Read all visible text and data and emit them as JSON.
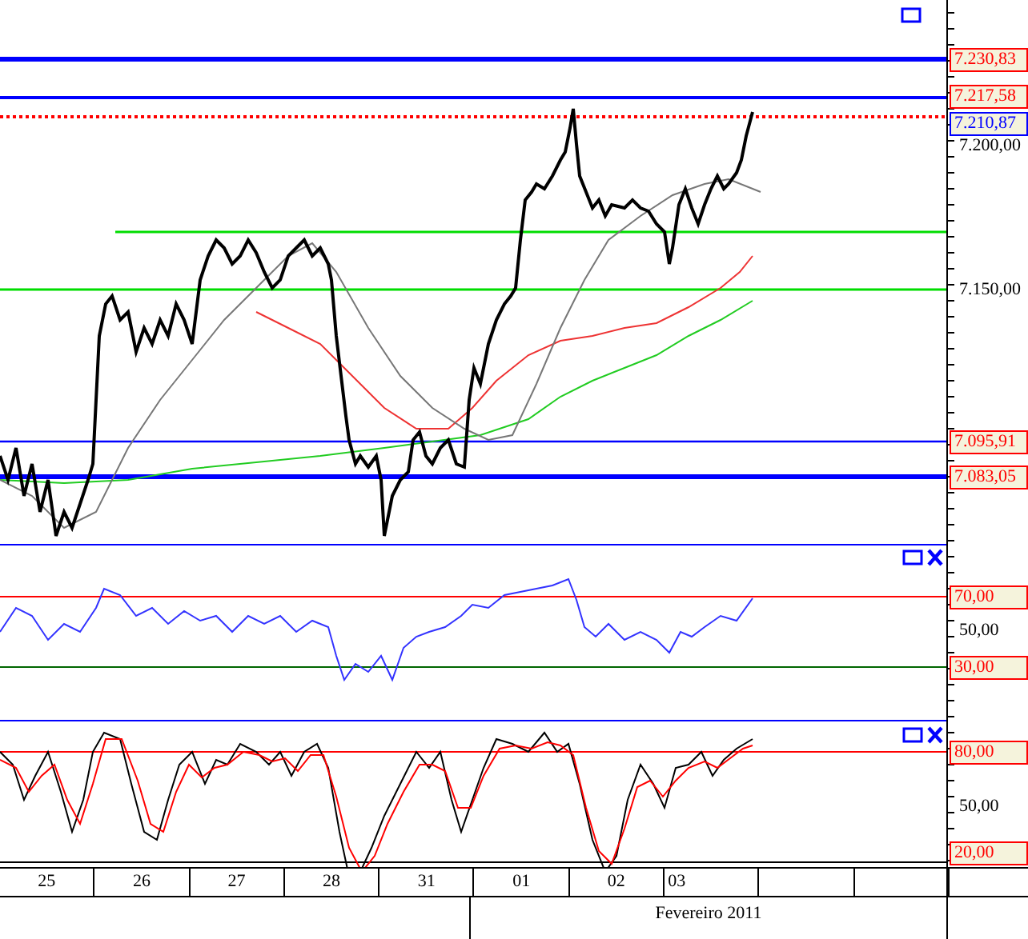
{
  "price_panel": {
    "axis_labels": [
      "7.200,00",
      "7.150,00"
    ],
    "price_tags": [
      {
        "label": "7.230,83",
        "kind": "level"
      },
      {
        "label": "7.217,58",
        "kind": "level"
      },
      {
        "label": "7.210,87",
        "kind": "last"
      },
      {
        "label": "7.095,91",
        "kind": "level"
      },
      {
        "label": "7.083,05",
        "kind": "level"
      }
    ]
  },
  "rsi_panel": {
    "axis_labels": [
      "50,00"
    ],
    "level_tags": [
      "70,00",
      "30,00"
    ]
  },
  "stochastic_panel": {
    "axis_labels": [
      "50,00"
    ],
    "level_tags": [
      "80,00",
      "20,00"
    ]
  },
  "time_axis": {
    "days": [
      "25",
      "26",
      "27",
      "28",
      "31",
      "01",
      "02",
      "03"
    ],
    "month": "Fevereiro 2011"
  }
}
